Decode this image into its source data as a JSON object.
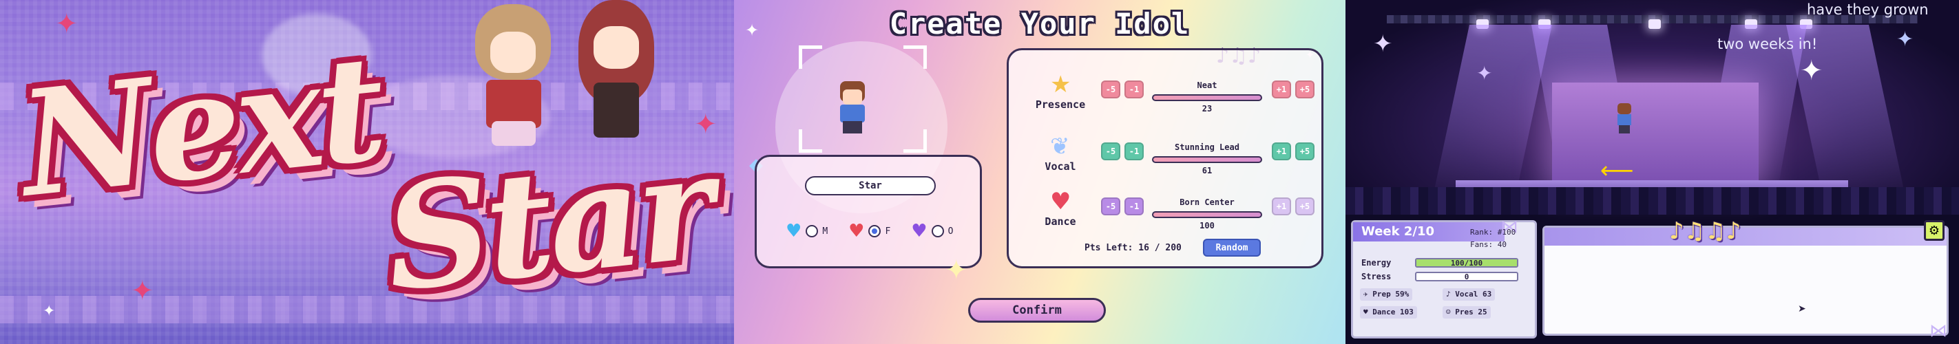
{
  "title_screen": {
    "logo_word_1": "Next",
    "logo_word_2": "Star"
  },
  "create_screen": {
    "title": "Create Your Idol",
    "name_value": "Star",
    "gender_options": [
      {
        "icon": "blue-heart-icon",
        "label": "M",
        "selected": false
      },
      {
        "icon": "red-heart-icon",
        "label": "F",
        "selected": true
      },
      {
        "icon": "purple-heart-icon",
        "label": "O",
        "selected": false
      }
    ],
    "stats": [
      {
        "label": "Presence",
        "icon": "star-icon",
        "trait": "Neat",
        "value": "23",
        "btn_color": "#f08a9d"
      },
      {
        "label": "Vocal",
        "icon": "wings-icon",
        "trait": "Stunning Lead",
        "value": "61",
        "btn_color": "#5fc7a8"
      },
      {
        "label": "Dance",
        "icon": "heart-icon",
        "trait": "Born Center",
        "value": "100",
        "btn_color": "#b88be6"
      }
    ],
    "buttons": {
      "minus5": "-5",
      "minus1": "-1",
      "plus1": "+1",
      "plus5": "+5"
    },
    "points_left": "Pts Left: 16 / 200",
    "random_label": "Random",
    "confirm_label": "Confirm"
  },
  "stage_screen": {
    "caption_line_1": "have they grown",
    "caption_line_2": "two weeks in!",
    "week_label": "Week 2/10",
    "rank": "Rank: #100",
    "fans": "Fans: 40",
    "energy_label": "Energy",
    "energy_value": "100/100",
    "energy_fraction": 1.0,
    "stress_label": "Stress",
    "stress_value": "0",
    "prep_label": "Prep",
    "prep_value": "59%",
    "vocal_label": "Vocal",
    "vocal_value": "63",
    "dance_label": "Dance",
    "dance_value": "103",
    "pres_label": "Pres",
    "pres_value": "25"
  },
  "colors": {
    "accent_pink": "#b4194a",
    "button_blue": "#5b79e0",
    "energy_green": "#a7df6c",
    "week_tab": "#8a73e6"
  }
}
